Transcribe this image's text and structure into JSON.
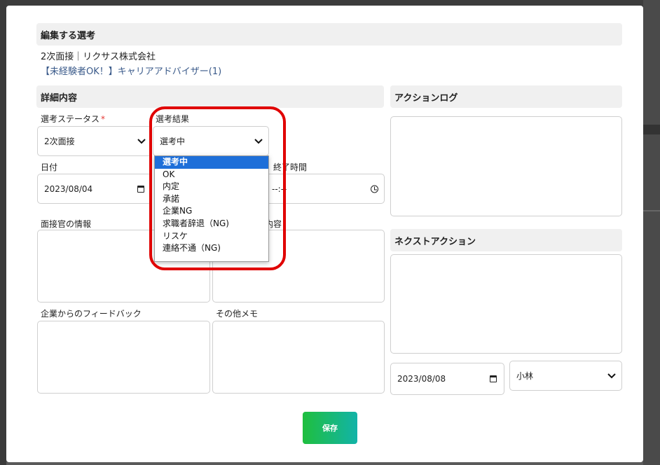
{
  "modal": {
    "heading": "編集する選考",
    "subtitle_line1": "2次面接｜リクサス株式会社",
    "subtitle_line2": "【未経験者OK！】キャリアアドバイザー(1)"
  },
  "details": {
    "section_title": "詳細内容",
    "status_label": "選考ステータス",
    "status_required_mark": "*",
    "status_value": "2次面接",
    "result_label": "選考結果",
    "result_value": "選考中",
    "date_label": "日付",
    "date_value": "2023/08/04",
    "end_time_label": "終了時間",
    "end_time_value": "--:--",
    "interviewer_label": "面接官の情報",
    "content_label_partial": "内容",
    "feedback_label": "企業からのフィードバック",
    "memo_label": "その他メモ"
  },
  "result_options": [
    "選考中",
    "OK",
    "内定",
    "承諾",
    "企業NG",
    "求職者辞退（NG)",
    "リスケ",
    "連絡不通（NG)"
  ],
  "action_log": {
    "section_title": "アクションログ"
  },
  "next_action": {
    "section_title": "ネクストアクション",
    "date_value": "2023/08/08",
    "assignee_value": "小林"
  },
  "save_button": {
    "label": "保存"
  },
  "colors": {
    "highlight": "#e00000",
    "selected_option": "#1e6fd9",
    "save_start": "#1fbf3e",
    "save_end": "#12b3a8"
  }
}
